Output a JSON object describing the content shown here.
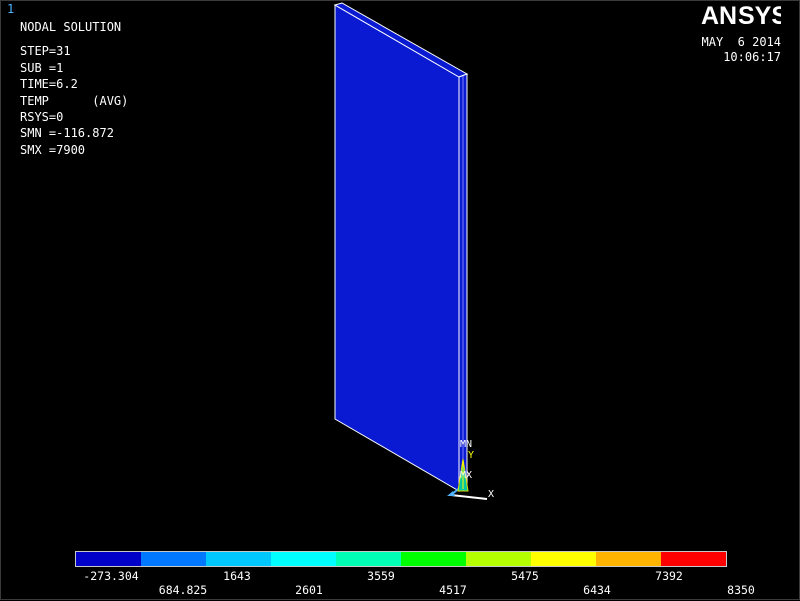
{
  "window_number": "1",
  "info": {
    "title": "NODAL SOLUTION",
    "lines": [
      "STEP=31",
      "SUB =1",
      "TIME=6.2",
      "TEMP      (AVG)",
      "RSYS=0",
      "SMN =-116.872",
      "SMX =7900"
    ]
  },
  "logo": {
    "text_a": "A",
    "text_n": "N",
    "text_sys": "SYS",
    "accent_color": "#f0b400"
  },
  "datetime": {
    "date": "MAY  6 2014",
    "time": "10:06:17"
  },
  "model": {
    "plate_color": "#0a1ad2",
    "edge_color": "#ffffff"
  },
  "triad": {
    "labels": [
      "MN",
      "Y",
      "MX",
      "X"
    ]
  },
  "legend": {
    "colors": [
      "#0000c8",
      "#0078ff",
      "#00c8ff",
      "#00ffff",
      "#00ffb4",
      "#00ff00",
      "#b4ff00",
      "#ffff00",
      "#ffb400",
      "#ff0000"
    ],
    "top_labels": [
      "-273.304",
      "1643",
      "3559",
      "5475",
      "7392"
    ],
    "bottom_labels": [
      "684.825",
      "2601",
      "4517",
      "6434",
      "8350"
    ]
  }
}
